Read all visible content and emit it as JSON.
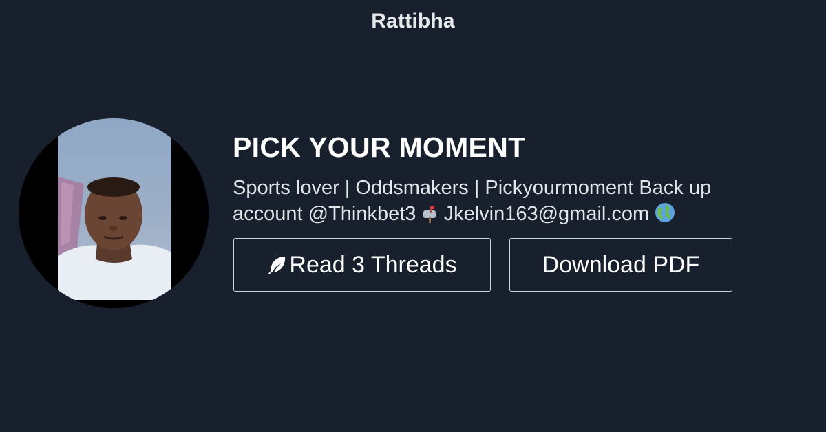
{
  "site": {
    "brand": "Rattibha"
  },
  "profile": {
    "name": "PICK YOUR MOMENT",
    "bio_line1": "Sports lover | Oddsmakers | Pickyourmoment Back up",
    "bio_line2_prefix": "account @Thinkbet3",
    "bio_line2_email": "Jkelvin163@gmail.com",
    "avatar_icon": "profile-photo",
    "mailbox_icon": "mailbox-icon",
    "globe_icon": "globe-icon"
  },
  "actions": {
    "read_label": "Read 3 Threads",
    "read_icon": "feather-icon",
    "pdf_label": "Download PDF"
  },
  "colors": {
    "background": "#17202c",
    "text": "#ffffff",
    "button_border": "#cfd4db"
  }
}
